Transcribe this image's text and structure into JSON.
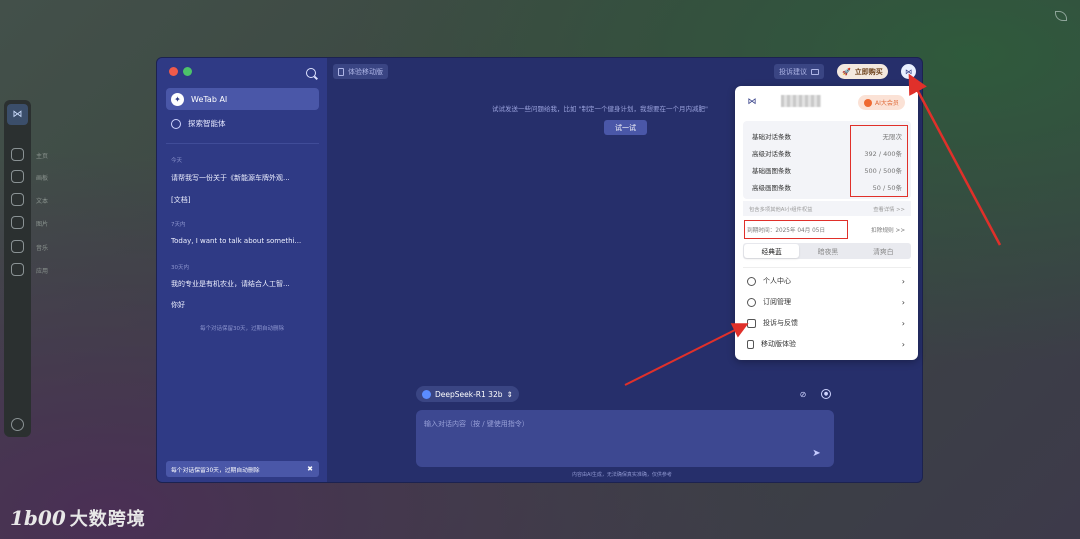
{
  "dock": {
    "labels": [
      "主页",
      "画板",
      "文本",
      "图片",
      "音乐",
      "应用"
    ]
  },
  "window": {
    "dot_colors": [
      "#f05a4a",
      "#4cc36a"
    ],
    "sidebar": {
      "active_item": "WeTab AI",
      "explore": "探索智能体",
      "groups": [
        {
          "label": "今天",
          "items": [
            "请帮我写一份关于《新能源车牌外观...",
            "[文档]"
          ]
        },
        {
          "label": "7天内",
          "items": [
            "Today, I want to talk about somethi..."
          ]
        },
        {
          "label": "30天内",
          "items": [
            "我的专业是有机农业，请结合人工智...",
            "你好"
          ]
        }
      ],
      "retention_note": "每个对话保留30天，过期自动删除",
      "banner": "每个对话保留30天，过期自动删除",
      "banner_close": "✖"
    },
    "topbar": {
      "mobile": "体验移动版",
      "feedback": "投诉建议",
      "buy": "立即购买",
      "avatar": "⋈"
    },
    "hint": "试试发送一些问题给我，比如 \"制定一个健身计划，我想要在一个月内减肥\"",
    "try_button": "试一试",
    "model": "DeepSeek-R1 32b",
    "model_arrow": "⇕",
    "input_placeholder": "输入对话内容（按 / 键使用指令）",
    "footer": "内容由AI生成，无法确保真实准确，仅供参考"
  },
  "popup": {
    "member_badge": "AI大会员",
    "quotas": [
      {
        "label": "基础对话条数",
        "value": "无限次"
      },
      {
        "label": "高级对话条数",
        "value": "392 / 400条"
      },
      {
        "label": "基础画图条数",
        "value": "500 / 500条"
      },
      {
        "label": "高级画图条数",
        "value": "50 / 50条"
      }
    ],
    "perk": "包含多项其他AI小组件权益",
    "perk_link": "查看详情 >>",
    "expiry": "到期时间：2025年 04月 05日",
    "rule": "扣除规则 >>",
    "themes": [
      "经典蓝",
      "暗夜黑",
      "清爽白"
    ],
    "menu": [
      "个人中心",
      "订阅管理",
      "投诉与反馈",
      "移动版体验"
    ]
  },
  "watermark": {
    "mark": "1b00",
    "text": "大数跨境"
  }
}
